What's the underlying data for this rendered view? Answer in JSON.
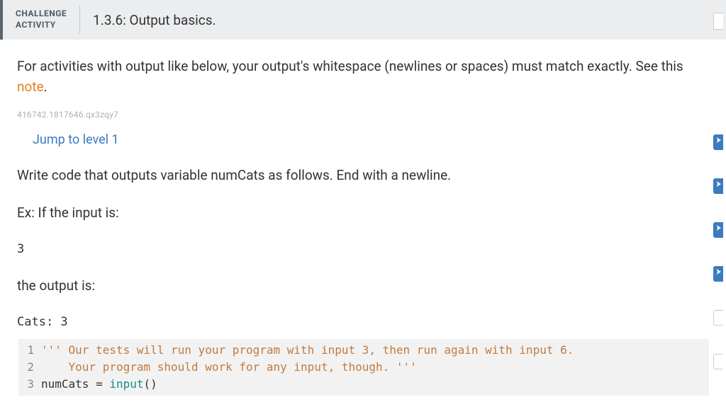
{
  "header": {
    "challenge_label_line1": "CHALLENGE",
    "challenge_label_line2": "ACTIVITY",
    "title": "1.3.6: Output basics."
  },
  "intro": {
    "text_before": "For activities with output like below, your output's whitespace (newlines or spaces) must match exactly. See this ",
    "link_text": "note",
    "text_after": "."
  },
  "session_id": "416742.1817646.qx3zqy7",
  "jump_link": "Jump to level 1",
  "instruction": "Write code that outputs variable numCats as follows. End with a newline.",
  "example_label": "Ex: If the input is:",
  "example_input": "3",
  "output_label": "the output is:",
  "example_output": "Cats: 3",
  "code": {
    "lines": [
      {
        "num": "1",
        "segments": [
          {
            "cls": "code-str",
            "text": "''' Our tests will run your program with input 3, then run again with input 6."
          }
        ]
      },
      {
        "num": "2",
        "segments": [
          {
            "cls": "code-str",
            "text": "    Your program should work for any input, though. '''"
          }
        ]
      },
      {
        "num": "3",
        "segments": [
          {
            "cls": "code-var",
            "text": "numCats "
          },
          {
            "cls": "code-op",
            "text": "= "
          },
          {
            "cls": "code-func",
            "text": "input"
          },
          {
            "cls": "code-paren",
            "text": "()"
          }
        ]
      }
    ]
  }
}
